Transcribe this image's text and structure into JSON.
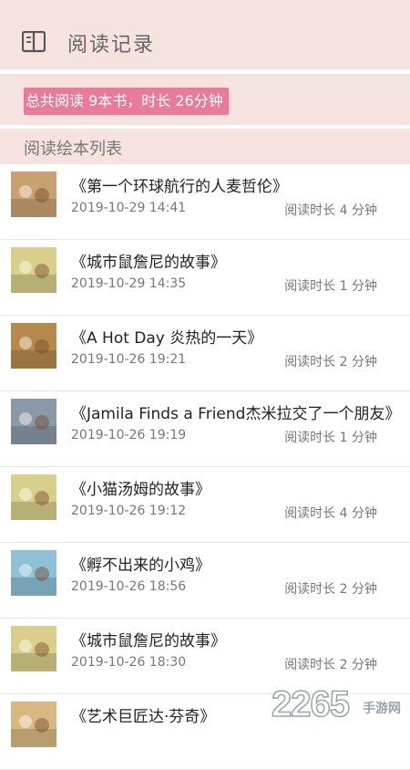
{
  "header": {
    "title": "阅读记录",
    "icon": "open-book-icon"
  },
  "summary": {
    "text": "总共阅读 9本书，时长 26分钟"
  },
  "section": {
    "title": "阅读绘本列表"
  },
  "books": [
    {
      "title": "《第一个环球航行的人麦哲伦》",
      "date": "2019-10-29 14:41",
      "duration": "阅读时长 4 分钟",
      "cover_color": "#c9a070"
    },
    {
      "title": "《城市鼠詹尼的故事》",
      "date": "2019-10-29 14:35",
      "duration": "阅读时长 1 分钟",
      "cover_color": "#d8cf8a"
    },
    {
      "title": "《A Hot Day  炎热的一天》",
      "date": "2019-10-26 19:21",
      "duration": "阅读时长 2 分钟",
      "cover_color": "#b58a4a"
    },
    {
      "title": "《Jamila Finds a Friend杰米拉交了一个朋友》",
      "date": "2019-10-26 19:19",
      "duration": "阅读时长 1 分钟",
      "cover_color": "#8a98a8"
    },
    {
      "title": "《小猫汤姆的故事》",
      "date": "2019-10-26 19:12",
      "duration": "阅读时长 4 分钟",
      "cover_color": "#d8cf8a"
    },
    {
      "title": "《孵不出来的小鸡》",
      "date": "2019-10-26 18:56",
      "duration": "阅读时长 2 分钟",
      "cover_color": "#8ec0d8"
    },
    {
      "title": "《城市鼠詹尼的故事》",
      "date": "2019-10-26 18:30",
      "duration": "阅读时长 2 分钟",
      "cover_color": "#d8cf8a"
    },
    {
      "title": "《艺术巨匠达·芬奇》",
      "date": "",
      "duration": "",
      "cover_color": "#d8b880"
    }
  ],
  "watermark": {
    "number": "2265",
    "text": "手游网"
  }
}
